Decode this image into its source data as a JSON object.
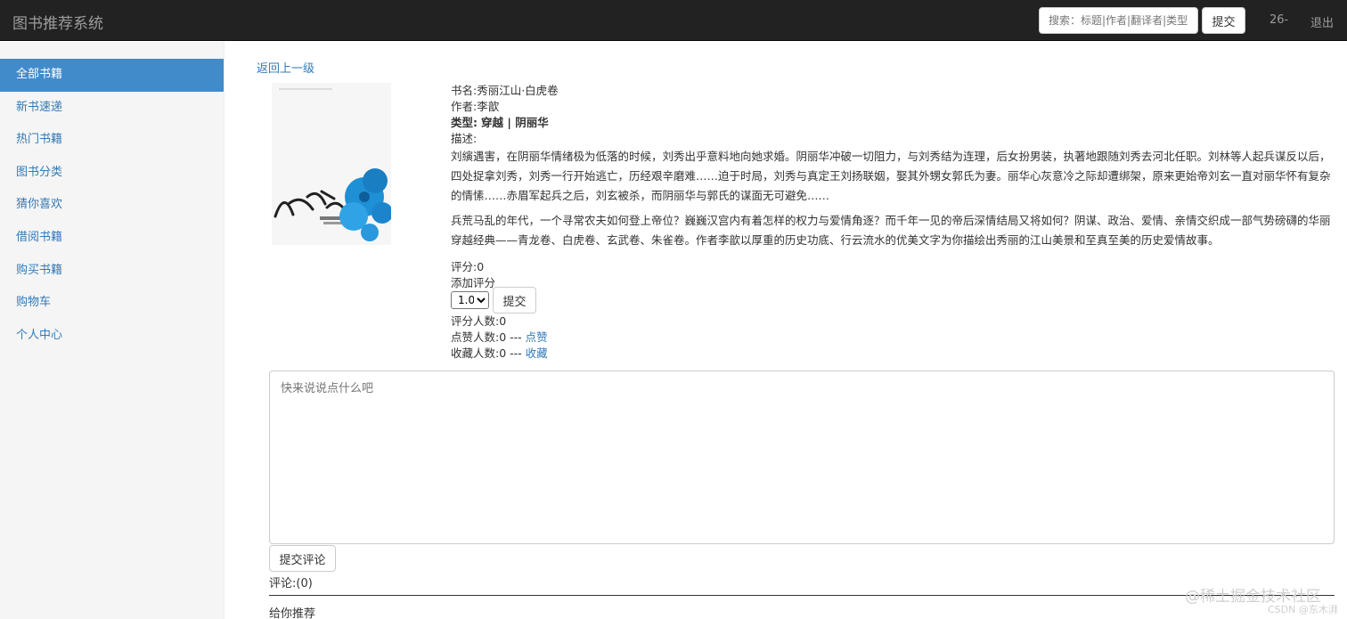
{
  "navbar": {
    "brand": "图书推荐系统",
    "search_placeholder": "搜索：标题|作者|翻译者|类型",
    "search_button": "提交",
    "user": "26-",
    "logout": "退出"
  },
  "sidebar": {
    "items": [
      {
        "label": "全部书籍",
        "active": true
      },
      {
        "label": "新书速递"
      },
      {
        "label": "热门书籍"
      },
      {
        "label": "图书分类"
      },
      {
        "label": "猜你喜欢"
      },
      {
        "label": "借阅书籍"
      },
      {
        "label": "购买书籍"
      },
      {
        "label": "购物车"
      },
      {
        "label": "个人中心"
      }
    ]
  },
  "book": {
    "back_link": "返回上一级",
    "title_line": "书名:秀丽江山·白虎卷",
    "author_line": "作者:李歆",
    "type_label": "类型:",
    "type_value": "穿越 | 阴丽华",
    "desc_label": "描述:",
    "desc_p1": "刘縯遇害，在阴丽华情绪极为低落的时候，刘秀出乎意料地向她求婚。阴丽华冲破一切阻力，与刘秀结为连理，后女扮男装，执著地跟随刘秀去河北任职。刘林等人起兵谋反以后，四处捉拿刘秀，刘秀一行开始逃亡，历经艰辛磨难……迫于时局，刘秀与真定王刘扬联姻，娶其外甥女郭氏为妻。丽华心灰意冷之际却遭绑架，原来更始帝刘玄一直对丽华怀有复杂的情愫……赤眉军起兵之后，刘玄被杀，而阴丽华与郭氏的谋面无可避免……",
    "desc_p2": "兵荒马乱的年代，一个寻常农夫如何登上帝位？巍巍汉宫内有着怎样的权力与爱情角逐？而千年一见的帝后深情结局又将如何？阴谋、政治、爱情、亲情交织成一部气势磅礴的华丽穿越经典——青龙卷、白虎卷、玄武卷、朱雀卷。作者李歆以厚重的历史功底、行云流水的优美文字为你描绘出秀丽的江山美景和至真至美的历史爱情故事。",
    "rating_line": "评分:0",
    "add_rating": "添加评分",
    "rating_selected": "1.0",
    "rating_submit": "提交",
    "raters_line": "评分人数:0",
    "likes_line": "点赞人数:0 --- ",
    "like_link": "点赞",
    "favs_line": "收藏人数:0 --- ",
    "fav_link": "收藏"
  },
  "comments": {
    "placeholder": "快来说说点什么吧",
    "submit": "提交评论",
    "count": "评论:(0)",
    "recommend_title": "给你推荐"
  },
  "watermark": "@稀土掘金技术社区",
  "watermark2": "CSDN @东木湃",
  "colors": {
    "navbar_bg": "#222222",
    "sidebar_active": "#428bca",
    "link": "#337ab7"
  }
}
